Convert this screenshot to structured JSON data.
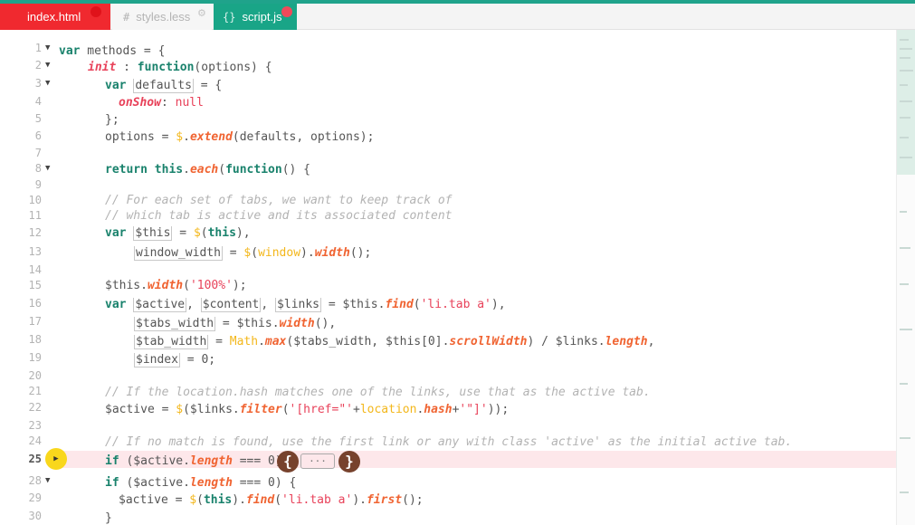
{
  "tabs": [
    {
      "label": "index.html",
      "icon": "",
      "status": "unsaved"
    },
    {
      "label": "styles.less",
      "icon": "#",
      "status": "modified"
    },
    {
      "label": "script.js",
      "icon": "{}",
      "status": "unsaved"
    }
  ],
  "editor": {
    "active_line": "25",
    "lines": [
      {
        "num": "1",
        "text": "var methods = {"
      },
      {
        "num": "2",
        "text": "init : function(options) {"
      },
      {
        "num": "3",
        "text": "var defaults = {"
      },
      {
        "num": "4",
        "text": "onShow: null"
      },
      {
        "num": "5",
        "text": "};"
      },
      {
        "num": "6",
        "text": "options = $.extend(defaults, options);"
      },
      {
        "num": "7",
        "text": ""
      },
      {
        "num": "8",
        "text": "return this.each(function() {"
      },
      {
        "num": "9",
        "text": ""
      },
      {
        "num": "10",
        "text": "// For each set of tabs, we want to keep track of"
      },
      {
        "num": "11",
        "text": "// which tab is active and its associated content"
      },
      {
        "num": "12",
        "text": "var $this = $(this),"
      },
      {
        "num": "13",
        "text": "window_width = $(window).width();"
      },
      {
        "num": "14",
        "text": ""
      },
      {
        "num": "15",
        "text": "$this.width('100%');"
      },
      {
        "num": "16",
        "text": "var $active, $content, $links = $this.find('li.tab a'),"
      },
      {
        "num": "17",
        "text": "$tabs_width = $this.width(),"
      },
      {
        "num": "18",
        "text": "$tab_width = Math.max($tabs_width, $this[0].scrollWidth) / $links.length,"
      },
      {
        "num": "19",
        "text": "$index = 0;"
      },
      {
        "num": "20",
        "text": ""
      },
      {
        "num": "21",
        "text": "// If the location.hash matches one of the links, use that as the active tab."
      },
      {
        "num": "22",
        "text": "$active = $($links.filter('[href=\"'+location.hash+'\"]'));"
      },
      {
        "num": "23",
        "text": ""
      },
      {
        "num": "24",
        "text": "// If no match is found, use the first link or any with class 'active' as the initial active tab."
      },
      {
        "num": "25",
        "text": "if ($active.length === 0) {"
      },
      {
        "num": "28",
        "text": "if ($active.length === 0) {"
      },
      {
        "num": "29",
        "text": "$active = $(this).find('li.tab a').first();"
      },
      {
        "num": "30",
        "text": "}"
      }
    ],
    "fold_placeholder": "···"
  },
  "colors": {
    "accent": "#1fa38b",
    "tab_unsaved": "#f0292f",
    "keyword": "#19826c",
    "string": "#e8425a",
    "method": "#f06432",
    "global": "#f3b71b",
    "highlight_line": "#fde7ea",
    "breakpoint": "#f9d71c"
  },
  "icons": [
    "hash-icon",
    "braces-icon",
    "close-icon",
    "fold-arrow-icon",
    "breakpoint-arrow-icon"
  ]
}
